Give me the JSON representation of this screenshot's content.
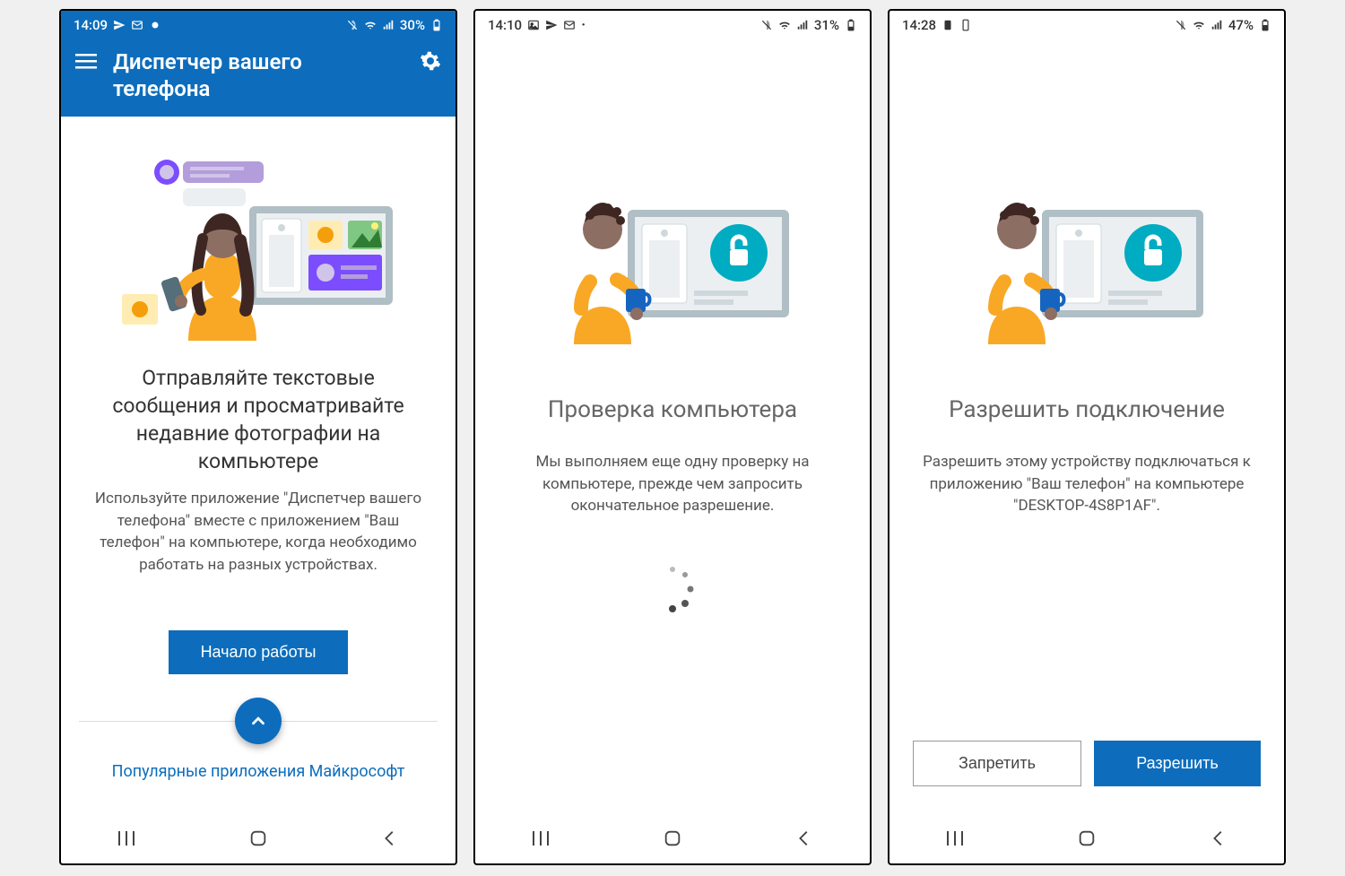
{
  "screens": [
    {
      "statusbar": {
        "time": "14:09",
        "battery": "30%"
      },
      "appbar": {
        "title": "Диспетчер вашего телефона"
      },
      "heading": "Отправляйте текстовые сообщения и просматривайте недавние фотографии на компьютере",
      "body": "Используйте приложение \"Диспетчер вашего телефона\" вместе с приложением \"Ваш телефон\" на компьютере, когда необходимо работать на разных устройствах.",
      "primary_button": "Начало работы",
      "popular_link": "Популярные приложения Майкрософт"
    },
    {
      "statusbar": {
        "time": "14:10",
        "battery": "31%"
      },
      "heading": "Проверка компьютера",
      "body": "Мы выполняем еще одну проверку на компьютере, прежде чем запросить окончательное разрешение."
    },
    {
      "statusbar": {
        "time": "14:28",
        "battery": "47%"
      },
      "heading": "Разрешить подключение",
      "body": "Разрешить этому устройству подключаться к приложению \"Ваш телефон\" на компьютере \"DESKTOP-4S8P1AF\".",
      "deny_button": "Запретить",
      "allow_button": "Разрешить"
    }
  ]
}
